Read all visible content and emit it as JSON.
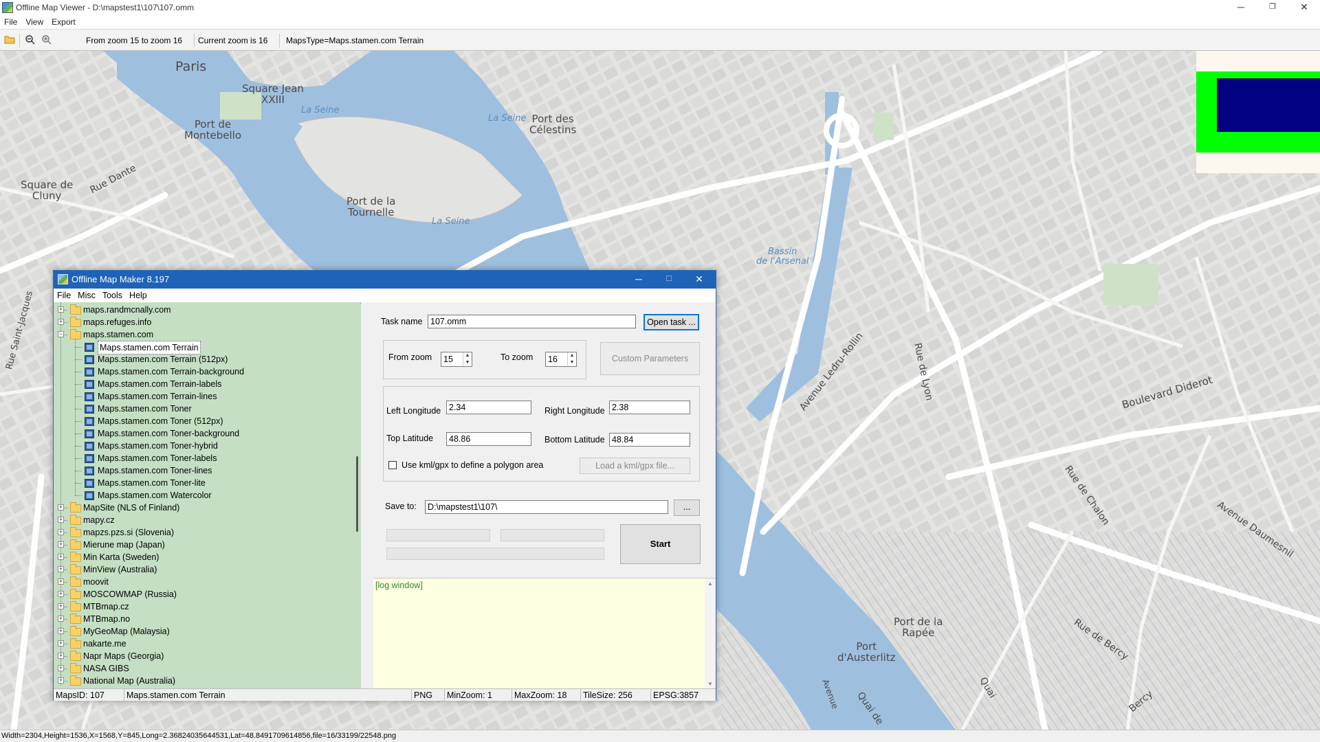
{
  "viewer": {
    "title": "Offline Map Viewer - D:\\mapstest1\\107\\107.omm",
    "menu": [
      "File",
      "View",
      "Export"
    ],
    "toolbar": {
      "zoom_range": "From zoom 15 to zoom 16",
      "current_zoom": "Current zoom is 16",
      "maps_type": "MapsType=Maps.stamen.com Terrain"
    },
    "status": "Width=2304,Height=1536,X=1568,Y=845,Long=2.3682403564453​1,Lat=48.8491709614856,file=16/33199/22548.png",
    "icons": [
      "open-folder-icon",
      "zoom-out-icon",
      "zoom-in-icon",
      "minimize-icon",
      "maximize-icon",
      "close-icon"
    ]
  },
  "map_labels": {
    "paris": "Paris",
    "square_jean": "Square Jean\nXXIII",
    "port_montebello": "Port de\nMontebello",
    "square_cluny": "Square de\nCluny",
    "rue_dante": "Rue Dante",
    "la_seine_1": "La Seine",
    "la_seine_2": "La Seine",
    "la_seine_3": "La Seine",
    "port_celestins": "Port des\nCélestins",
    "port_tournelle": "Port de la\nTournelle",
    "bassin_arsenal": "Bassin\nde l'Arsenal",
    "rue_saint_jacques": "Rue Saint-Jacques",
    "avenue_ledru_rollin": "Avenue Ledru-Rollin",
    "rue_de_lyon": "Rue de Lyon",
    "boulevard_diderot": "Boulevard Diderot",
    "rue_de_chalon": "Rue de Chalon",
    "avenue_daumesnil": "Avenue Daumesnil",
    "rue_de_bercy": "Rue de Bercy",
    "port_rapee": "Port de la\nRapée",
    "port_austerlitz": "Port\nd'Austerlitz",
    "quai_de": "Quai de",
    "quai": "Quai",
    "bercy": "Bercy",
    "avenue": "Avenue"
  },
  "dialog": {
    "title": "Offline Map Maker 8.197",
    "menu": [
      "File",
      "Misc",
      "Tools",
      "Help"
    ],
    "tree": [
      {
        "label": "maps.randmcnally.com",
        "level": 0,
        "type": "folder",
        "expanded": false
      },
      {
        "label": "maps.refuges.info",
        "level": 0,
        "type": "folder",
        "expanded": false
      },
      {
        "label": "maps.stamen.com",
        "level": 0,
        "type": "folder",
        "expanded": true
      },
      {
        "label": "Maps.stamen.com Terrain",
        "level": 1,
        "type": "map",
        "selected": true
      },
      {
        "label": "Maps.stamen.com Terrain (512px)",
        "level": 1,
        "type": "map"
      },
      {
        "label": "Maps.stamen.com Terrain-background",
        "level": 1,
        "type": "map"
      },
      {
        "label": "Maps.stamen.com Terrain-labels",
        "level": 1,
        "type": "map"
      },
      {
        "label": "Maps.stamen.com Terrain-lines",
        "level": 1,
        "type": "map"
      },
      {
        "label": "Maps.stamen.com Toner",
        "level": 1,
        "type": "map"
      },
      {
        "label": "Maps.stamen.com Toner (512px)",
        "level": 1,
        "type": "map"
      },
      {
        "label": "Maps.stamen.com Toner-background",
        "level": 1,
        "type": "map"
      },
      {
        "label": "Maps.stamen.com Toner-hybrid",
        "level": 1,
        "type": "map"
      },
      {
        "label": "Maps.stamen.com Toner-labels",
        "level": 1,
        "type": "map"
      },
      {
        "label": "Maps.stamen.com Toner-lines",
        "level": 1,
        "type": "map"
      },
      {
        "label": "Maps.stamen.com Toner-lite",
        "level": 1,
        "type": "map"
      },
      {
        "label": "Maps.stamen.com Watercolor",
        "level": 1,
        "type": "map"
      },
      {
        "label": "MapSite (NLS of Finland)",
        "level": 0,
        "type": "folder",
        "expanded": false
      },
      {
        "label": "mapy.cz",
        "level": 0,
        "type": "folder",
        "expanded": false
      },
      {
        "label": "mapzs.pzs.si (Slovenia)",
        "level": 0,
        "type": "folder",
        "expanded": false
      },
      {
        "label": "Mierune map (Japan)",
        "level": 0,
        "type": "folder",
        "expanded": false
      },
      {
        "label": "Min Karta (Sweden)",
        "level": 0,
        "type": "folder",
        "expanded": false
      },
      {
        "label": "MinView (Australia)",
        "level": 0,
        "type": "folder",
        "expanded": false
      },
      {
        "label": "moovit",
        "level": 0,
        "type": "folder",
        "expanded": false
      },
      {
        "label": "MOSCOWMAP (Russia)",
        "level": 0,
        "type": "folder",
        "expanded": false
      },
      {
        "label": "MTBmap.cz",
        "level": 0,
        "type": "folder",
        "expanded": false
      },
      {
        "label": "MTBmap.no",
        "level": 0,
        "type": "folder",
        "expanded": false
      },
      {
        "label": "MyGeoMap (Malaysia)",
        "level": 0,
        "type": "folder",
        "expanded": false
      },
      {
        "label": "nakarte.me",
        "level": 0,
        "type": "folder",
        "expanded": false
      },
      {
        "label": "Napr Maps (Georgia)",
        "level": 0,
        "type": "folder",
        "expanded": false
      },
      {
        "label": "NASA GIBS",
        "level": 0,
        "type": "folder",
        "expanded": false
      },
      {
        "label": "National Map (Australia)",
        "level": 0,
        "type": "folder",
        "expanded": false
      }
    ],
    "task_name_label": "Task name",
    "task_name_value": "107.omm",
    "open_task_label": "Open task ...",
    "from_zoom_label": "From zoom",
    "from_zoom_value": "15",
    "to_zoom_label": "To zoom",
    "to_zoom_value": "16",
    "custom_params_label": "Custom Parameters",
    "left_lon_label": "Left Longitude",
    "left_lon_value": "2.34",
    "right_lon_label": "Right Longitude",
    "right_lon_value": "2.38",
    "top_lat_label": "Top Latitude",
    "top_lat_value": "48.86",
    "bottom_lat_label": "Bottom Latitude",
    "bottom_lat_value": "48.84",
    "kml_checkbox_label": "Use kml/gpx to define a polygon area",
    "kml_checked": false,
    "load_kml_label": "Load a kml/gpx file...",
    "save_to_label": "Save to:",
    "save_to_value": "D:\\mapstest1\\107\\",
    "browse_label": "...",
    "start_label": "Start",
    "log_text": "[log window]",
    "status": {
      "maps_id": "MapsID: 107",
      "map_name": "Maps.stamen.com Terrain",
      "format": "PNG",
      "min_zoom": "MinZoom: 1",
      "max_zoom": "MaxZoom: 18",
      "tile_size": "TileSize: 256",
      "epsg": "EPSG:3857"
    }
  },
  "colors": {
    "dialog_title": "#1e63b8",
    "tree_bg": "#c4dfc4",
    "log_bg": "#ffffe1",
    "water": "#9fbfdf",
    "legend_green": "#00ff00",
    "legend_navy": "#000080"
  }
}
